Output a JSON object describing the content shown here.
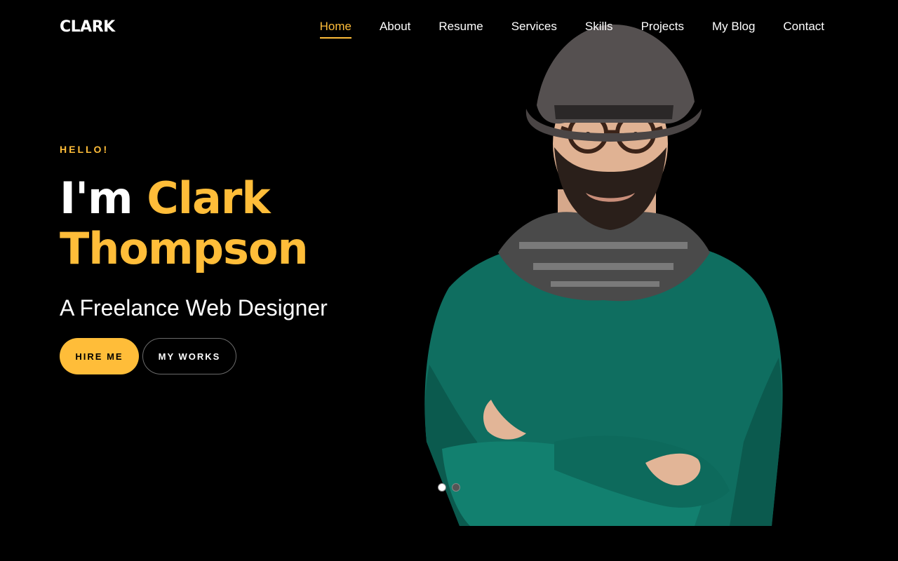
{
  "brand": {
    "logo": "CLARK"
  },
  "nav": {
    "items": [
      {
        "label": "Home",
        "active": true
      },
      {
        "label": "About",
        "active": false
      },
      {
        "label": "Resume",
        "active": false
      },
      {
        "label": "Services",
        "active": false
      },
      {
        "label": "Skills",
        "active": false
      },
      {
        "label": "Projects",
        "active": false
      },
      {
        "label": "My Blog",
        "active": false
      },
      {
        "label": "Contact",
        "active": false
      }
    ]
  },
  "hero": {
    "greeting": "HELLO!",
    "intro": "I'm",
    "name_first": "Clark",
    "name_last": "Thompson",
    "subtitle": "A Freelance Web Designer",
    "primary_button": "HIRE ME",
    "secondary_button": "MY WORKS"
  },
  "slider": {
    "slide_count": 2,
    "active_slide": 1
  },
  "colors": {
    "accent": "#ffbd39",
    "background": "#000000",
    "sweater": "#0f6e60"
  }
}
